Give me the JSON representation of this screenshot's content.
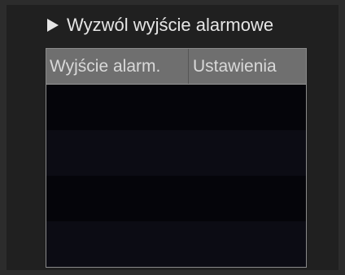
{
  "header": {
    "title": "Wyzwól wyjście alarmowe"
  },
  "table": {
    "columns": [
      "Wyjście alarm.",
      "Ustawienia"
    ],
    "rows": [
      {
        "output": "",
        "settings": ""
      },
      {
        "output": "",
        "settings": ""
      },
      {
        "output": "",
        "settings": ""
      },
      {
        "output": "",
        "settings": ""
      }
    ]
  }
}
